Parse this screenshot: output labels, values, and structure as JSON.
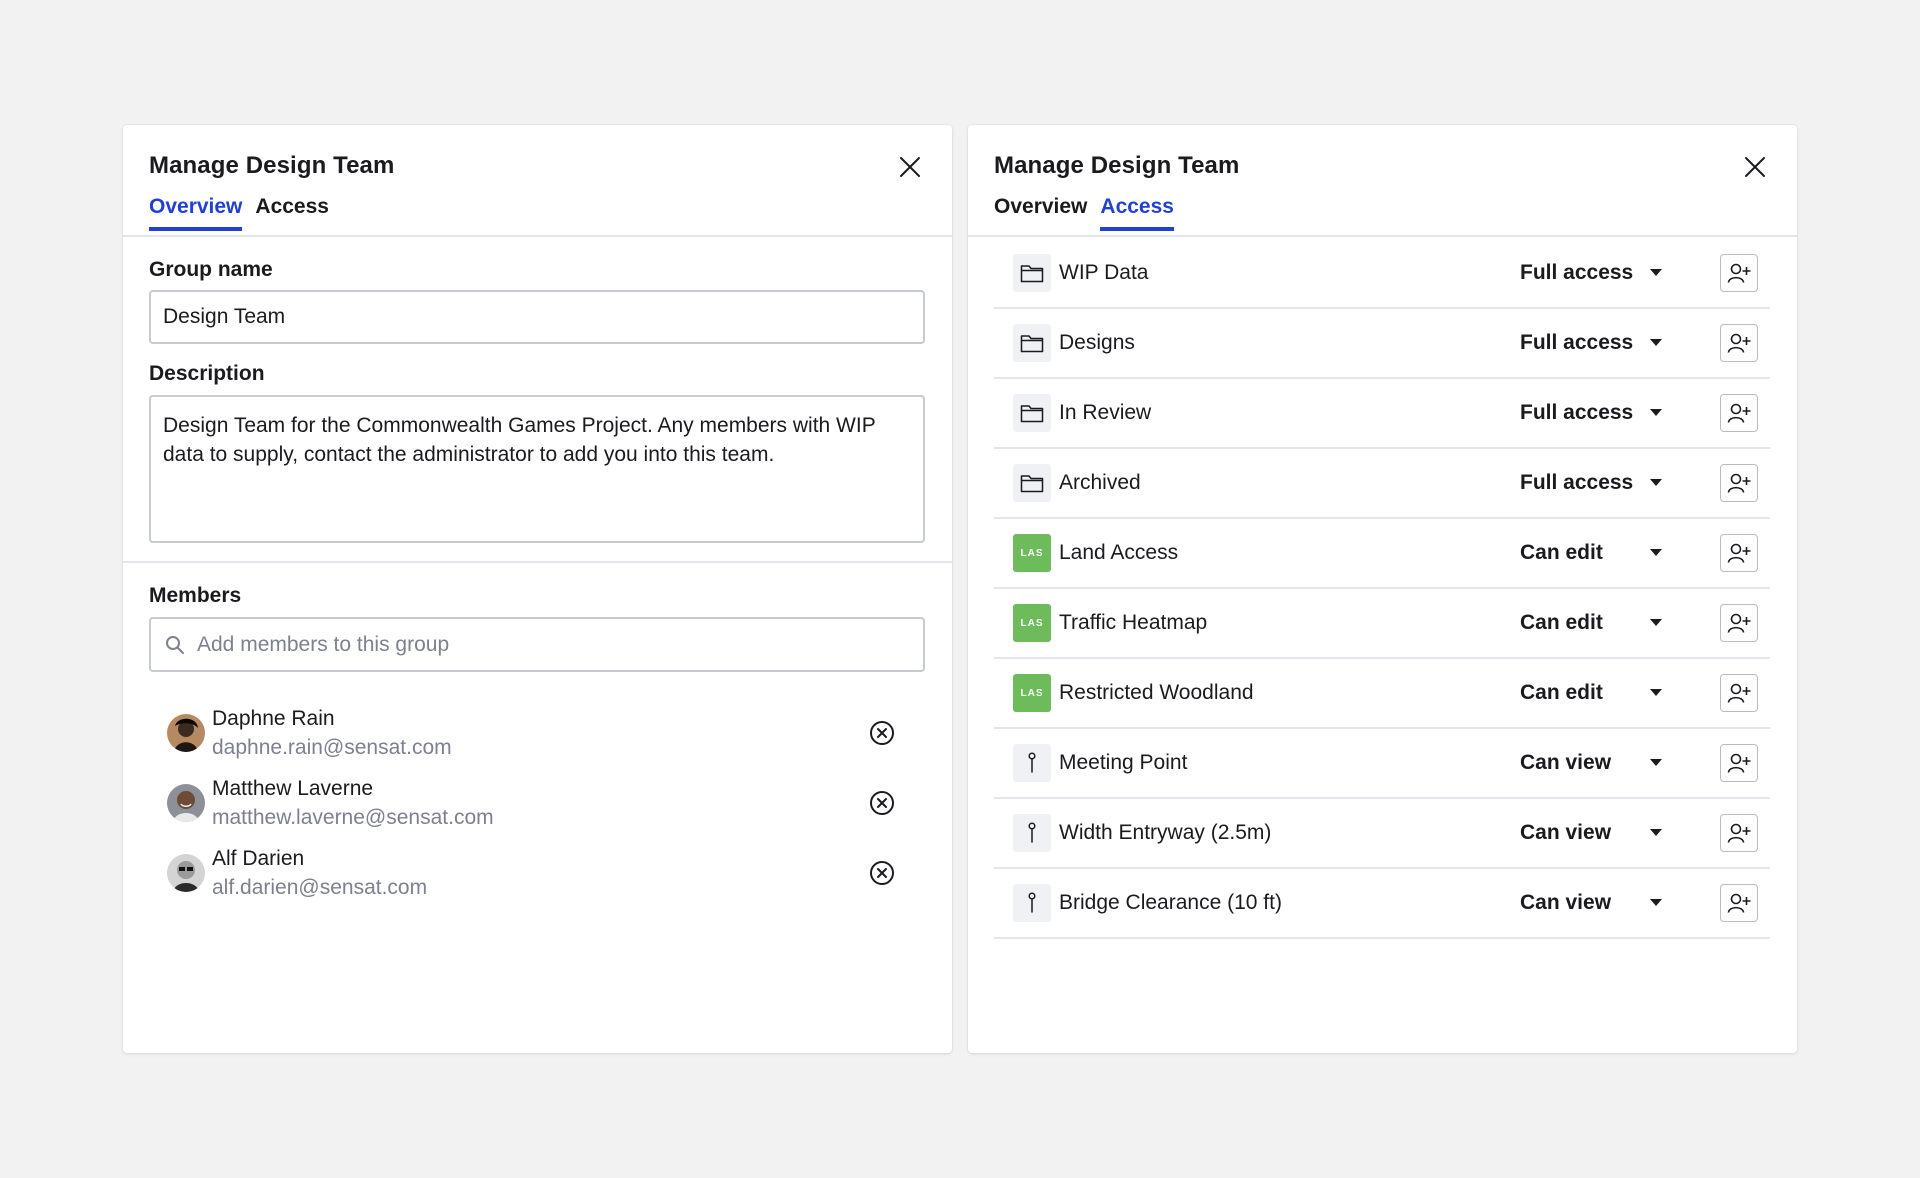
{
  "colors": {
    "accent": "#2240d6",
    "las_badge": "#6dbb5b",
    "background": "#f2f2f2",
    "muted_text": "#7d818f"
  },
  "overview_panel": {
    "title": "Manage Design Team",
    "tabs": [
      {
        "label": "Overview",
        "active": true
      },
      {
        "label": "Access",
        "active": false
      }
    ],
    "group_name": {
      "label": "Group name",
      "value": "Design Team"
    },
    "description": {
      "label": "Description",
      "value": "Design Team for the Commonwealth Games Project. Any members with WIP data to supply, contact the administrator to add you into this team."
    },
    "members": {
      "label": "Members",
      "search_placeholder": "Add members to this group",
      "list": [
        {
          "name": "Daphne Rain",
          "email": "daphne.rain@sensat.com"
        },
        {
          "name": "Matthew Laverne",
          "email": "matthew.laverne@sensat.com"
        },
        {
          "name": "Alf Darien",
          "email": "alf.darien@sensat.com"
        }
      ]
    }
  },
  "access_panel": {
    "title": "Manage Design Team",
    "tabs": [
      {
        "label": "Overview",
        "active": false
      },
      {
        "label": "Access",
        "active": true
      }
    ],
    "badge_text": "LAS",
    "items": [
      {
        "name": "WIP Data",
        "icon": "folder-icon",
        "permission": "Full access"
      },
      {
        "name": "Designs",
        "icon": "folder-icon",
        "permission": "Full access"
      },
      {
        "name": "In Review",
        "icon": "folder-icon",
        "permission": "Full access"
      },
      {
        "name": "Archived",
        "icon": "folder-icon",
        "permission": "Full access"
      },
      {
        "name": "Land Access",
        "icon": "las-badge-icon",
        "permission": "Can edit"
      },
      {
        "name": "Traffic Heatmap",
        "icon": "las-badge-icon",
        "permission": "Can edit"
      },
      {
        "name": "Restricted Woodland",
        "icon": "las-badge-icon",
        "permission": "Can edit"
      },
      {
        "name": "Meeting Point",
        "icon": "pin-icon",
        "permission": "Can view"
      },
      {
        "name": "Width Entryway (2.5m)",
        "icon": "pin-icon",
        "permission": "Can view"
      },
      {
        "name": "Bridge Clearance (10 ft)",
        "icon": "pin-icon",
        "permission": "Can view"
      }
    ]
  }
}
